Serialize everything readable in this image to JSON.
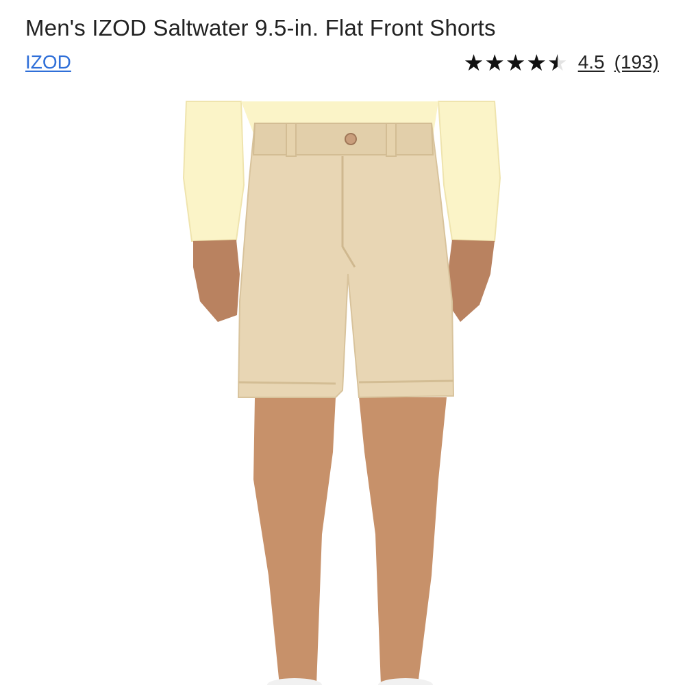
{
  "product": {
    "title": "Men's IZOD Saltwater 9.5-in. Flat Front Shorts",
    "brand": "IZOD",
    "rating_value": "4.5",
    "rating_fraction": 0.9,
    "review_count": "(193)",
    "stars": "★★★★★"
  },
  "colors": {
    "brand_link": "#2f6fd8",
    "shorts": "#e8d6b4",
    "shirt": "#fbf4c8",
    "skin": "#c7916a",
    "star_filled": "#111111",
    "star_empty": "#e3e3e3"
  },
  "icons": {
    "rating": "star-icon"
  }
}
